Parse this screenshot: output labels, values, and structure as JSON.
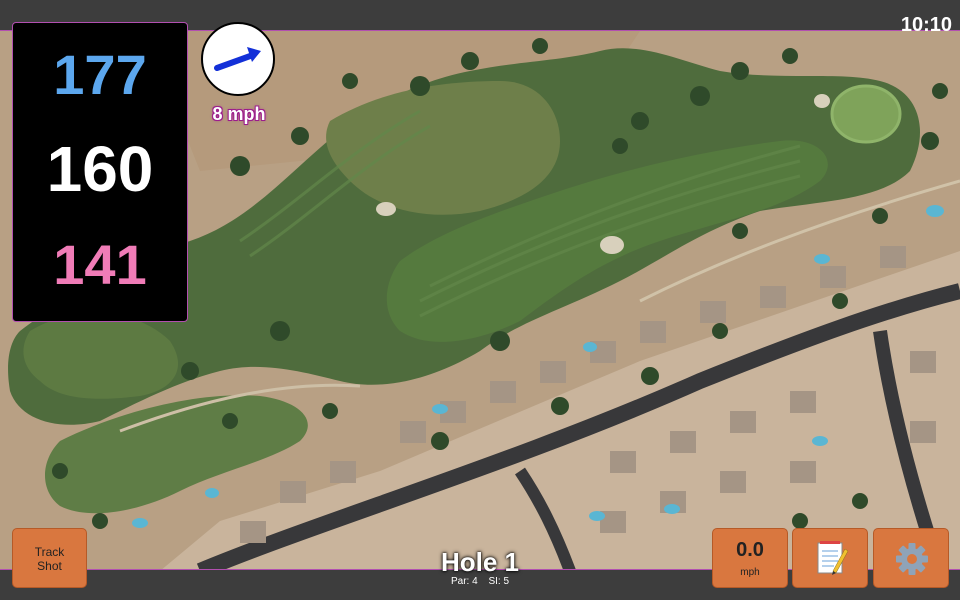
{
  "status": {
    "time": "10:10"
  },
  "distances": {
    "back": "177",
    "middle": "160",
    "front": "141"
  },
  "wind": {
    "speed_label": "8 mph",
    "direction_icon": "arrow-icon"
  },
  "hole": {
    "title": "Hole 1",
    "par_label": "Par: 4",
    "si_label": "SI: 5"
  },
  "buttons": {
    "track_line1": "Track",
    "track_line2": "Shot",
    "speed_value": "0.0",
    "speed_unit": "mph",
    "notes_icon": "notepad-icon",
    "settings_icon": "gear-icon"
  },
  "colors": {
    "back": "#5ca7ee",
    "middle": "#ffffff",
    "front": "#f07cb7",
    "button": "#d9773f",
    "accent_border": "#b24fb0"
  }
}
